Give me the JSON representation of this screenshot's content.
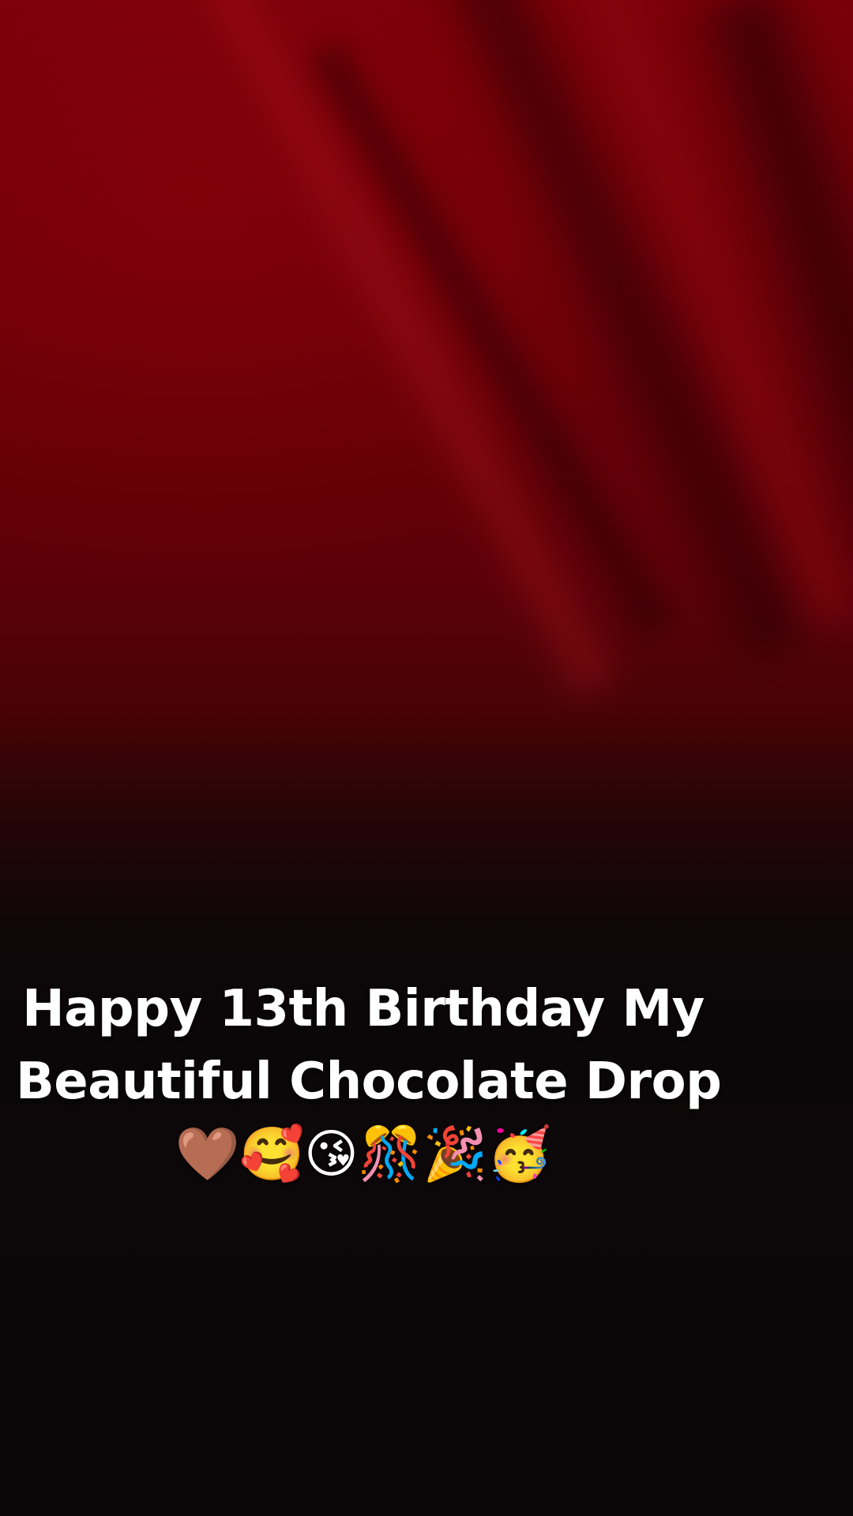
{
  "caption": {
    "line1": "Happy 13th Birthday My",
    "line2": "Beautiful Chocolate Drop",
    "emojis": "🤎🥰😘🎊🎉🥳"
  },
  "colors": {
    "background_top": "#7a0008",
    "background_bottom": "#0a0708",
    "text": "#ffffff"
  }
}
